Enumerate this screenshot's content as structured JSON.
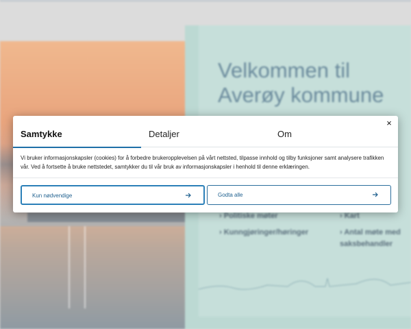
{
  "background": {
    "title": "Velkommen til Averøy kommune",
    "links_left": [
      "Politiske møter",
      "Kunngjøringer/høringer"
    ],
    "links_right": [
      "Kart",
      "Antal møte med saksbehandler"
    ],
    "panel_color": "#c6dfda"
  },
  "consent": {
    "tabs": [
      {
        "label": "Samtykke",
        "active": true
      },
      {
        "label": "Detaljer",
        "active": false
      },
      {
        "label": "Om",
        "active": false
      }
    ],
    "close_label": "×",
    "message": "Vi bruker informasjonskapsler (cookies) for å forbedre brukeropplevelsen på vårt nettsted, tilpasse innhold og tilby funksjoner samt analysere trafikken vår. Ved å fortsette å bruke nettstedet, samtykker du til vår bruk av informasjonskapsler i henhold til denne erklæringen.",
    "buttons": {
      "necessary_label": "Kun nødvendige",
      "accept_all_label": "Godta alle"
    },
    "accent_color": "#1e6fa8"
  }
}
